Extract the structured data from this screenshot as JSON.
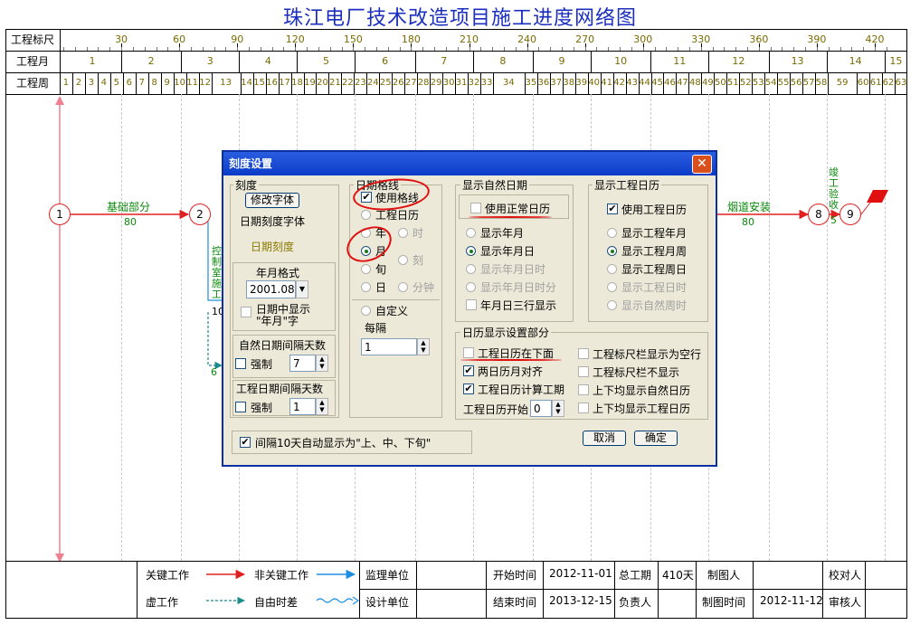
{
  "title": "珠江电厂技术改造项目施工进度网络图",
  "ruler": {
    "label_scale": "工程标尺",
    "label_month": "工程月",
    "label_week": "工程周",
    "scale_ticks": [
      "30",
      "60",
      "90",
      "120",
      "150",
      "180",
      "210",
      "240",
      "270",
      "300",
      "330",
      "360",
      "390",
      "420"
    ],
    "months": [
      "1",
      "2",
      "3",
      "4",
      "5",
      "6",
      "7",
      "8",
      "9",
      "10",
      "11",
      "12",
      "13",
      "14",
      "15"
    ],
    "weeks": [
      "1",
      "2",
      "3",
      "4",
      "5",
      "6",
      "7",
      "8",
      "9",
      "10",
      "11",
      "12",
      "13",
      "14",
      "15",
      "16",
      "17",
      "18",
      "19",
      "20",
      "21",
      "22",
      "23",
      "24",
      "25",
      "26",
      "27",
      "28",
      "29",
      "30",
      "31",
      "32",
      "33",
      "34",
      "35",
      "36",
      "37",
      "38",
      "39",
      "40",
      "41",
      "42",
      "43",
      "44",
      "45",
      "46",
      "47",
      "48",
      "49",
      "50",
      "51",
      "52",
      "53",
      "54",
      "55",
      "56",
      "57",
      "58",
      "59",
      "60",
      "61",
      "62",
      "63"
    ]
  },
  "network": {
    "nodes": [
      "1",
      "2",
      "8",
      "9"
    ],
    "act_foundation": "基础部分",
    "act_foundation_days": "80",
    "act_chimney": "烟道安装",
    "act_chimney_days": "80",
    "act_complete": "竣工验收",
    "act_complete_days": "5",
    "act_partial": "控制室施工",
    "act_partial_days": "10",
    "act_float": "6"
  },
  "dialog": {
    "title": "刻度设置",
    "scale_group": "刻度",
    "change_font_btn": "修改字体",
    "date_scale_font": "日期刻度字体",
    "date_scale": "日期刻度",
    "ym_format_group": "年月格式",
    "ym_format_value": "2001.08",
    "show_ym_in_date": "日期中显示\n\"年月\"字",
    "natural_interval_group": "自然日期间隔天数",
    "force1": "强制",
    "natural_interval_value": "7",
    "work_interval_group": "工程日期间隔天数",
    "force2": "强制",
    "work_interval_value": "1",
    "grid_group": "日期格线",
    "use_grid": "使用格线",
    "work_calendar": "工程日历",
    "opt_year": "年",
    "opt_hour": "时",
    "opt_month": "月",
    "opt_quarter": "刻",
    "opt_ten": "旬",
    "opt_day": "日",
    "opt_minute": "分钟",
    "opt_custom": "自定义",
    "every": "每隔",
    "every_value": "1",
    "natural_date_group": "显示自然日期",
    "use_normal_calendar": "使用正常日历",
    "show_ym": "显示年月",
    "show_ymd": "显示年月日",
    "show_ymdh": "显示年月日时",
    "show_ymdhm": "显示年月日时分",
    "ymd_three_rows": "年月日三行显示",
    "work_calendar_group": "显示工程日历",
    "use_work_calendar": "使用工程日历",
    "show_work_ym": "显示工程年月",
    "show_work_mw": "显示工程月周",
    "show_work_wd": "显示工程周日",
    "show_work_dh": "显示工程日时",
    "show_natural_wh": "显示自然周时",
    "cal_settings_group": "日历显示设置部分",
    "work_cal_below": "工程日历在下面",
    "two_cal_align": "两日历月对齐",
    "work_cal_period": "工程日历计算工期",
    "work_cal_start": "工程日历开始",
    "work_cal_start_value": "0",
    "ruler_empty_row": "工程标尺栏显示为空行",
    "ruler_hide": "工程标尺栏不显示",
    "both_natural": "上下均显示自然日历",
    "both_work": "上下均显示工程日历",
    "auto_ten": "间隔10天自动显示为\"上、中、下旬\"",
    "cancel": "取消",
    "ok": "确定"
  },
  "footer": {
    "key_work": "关键工作",
    "nonkey_work": "非关键工作",
    "dummy_work": "虚工作",
    "free_float": "自由时差",
    "supervisor": "监理单位",
    "designer": "设计单位",
    "start_label": "开始时间",
    "start_value": "2012-11-01",
    "end_label": "结束时间",
    "end_value": "2013-12-15",
    "total_label": "总工期",
    "total_value": "410天",
    "owner_label": "负责人",
    "drafter_label": "制图人",
    "draft_time_label": "制图时间",
    "draft_time_value": "2012-11-12",
    "checker_label": "校对人",
    "reviewer_label": "审核人"
  },
  "colors": {
    "title": "#1a2fbf",
    "critical": "#e02020",
    "noncritical": "#1e8fe0",
    "activity_label": "#0a8a0a",
    "dialog_title": "#0a3bc8"
  }
}
